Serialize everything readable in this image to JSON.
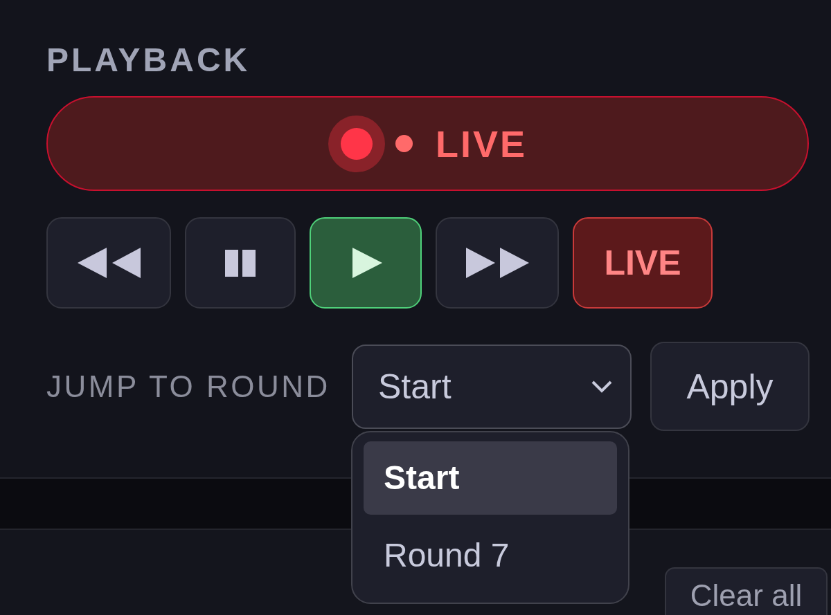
{
  "playback": {
    "heading": "PLAYBACK",
    "live_status": {
      "label": "LIVE",
      "active": true
    },
    "transport": [
      {
        "kind": "rewind",
        "active": false
      },
      {
        "kind": "pause",
        "active": false
      },
      {
        "kind": "play",
        "active": true
      },
      {
        "kind": "fast_forward",
        "active": false
      },
      {
        "kind": "live",
        "label": "LIVE",
        "active": false
      }
    ],
    "jump": {
      "label": "JUMP TO ROUND",
      "select": {
        "value": "Start",
        "expanded": true,
        "options": [
          {
            "label": "Start",
            "selected": true
          },
          {
            "label": "Round 7",
            "selected": false
          }
        ]
      },
      "apply_button": "Apply"
    }
  },
  "lower_panel": {
    "clear_button": "Clear all"
  }
}
